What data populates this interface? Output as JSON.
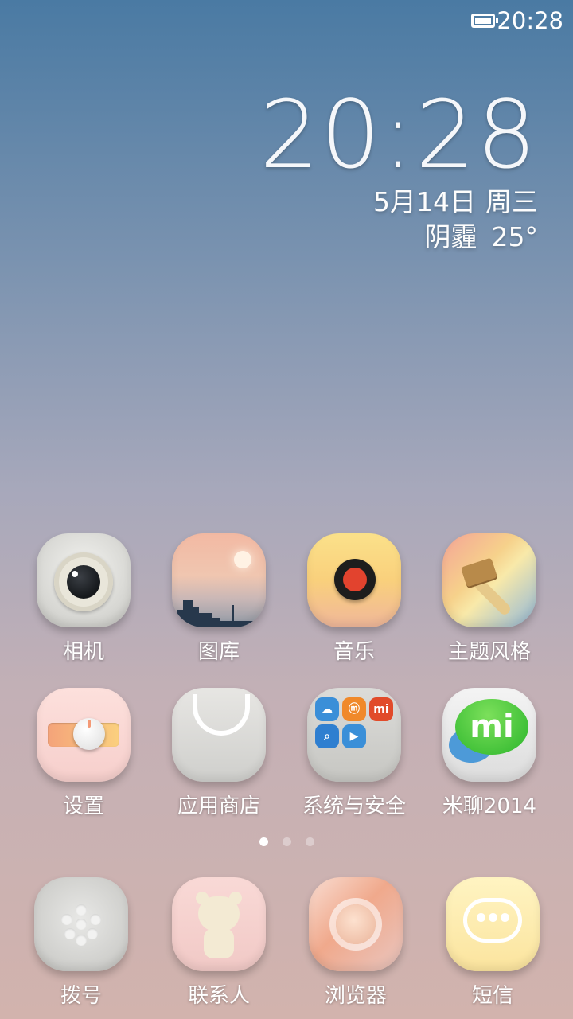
{
  "status_bar": {
    "time": "20:28",
    "battery_icon": "battery-full-icon"
  },
  "clock_widget": {
    "time": "20:28",
    "date": "5月14日",
    "weekday": "周三",
    "weather": "阴霾",
    "temperature": "25°"
  },
  "apps": [
    {
      "label": "相机",
      "icon": "camera-icon"
    },
    {
      "label": "图库",
      "icon": "gallery-icon"
    },
    {
      "label": "音乐",
      "icon": "music-icon"
    },
    {
      "label": "主题风格",
      "icon": "theme-brush-icon"
    },
    {
      "label": "设置",
      "icon": "settings-toggle-icon"
    },
    {
      "label": "应用商店",
      "icon": "app-store-bag-icon"
    },
    {
      "label": "系统与安全",
      "icon": "folder-icon"
    },
    {
      "label": "米聊2014",
      "icon": "mitalk-icon"
    }
  ],
  "folder_minis": [
    "cloud",
    "mi",
    "mi",
    "search",
    "play"
  ],
  "mitalk_text": "mi",
  "page_indicator": {
    "pages": 3,
    "active": 0
  },
  "dock": [
    {
      "label": "拨号",
      "icon": "dialer-icon"
    },
    {
      "label": "联系人",
      "icon": "contacts-icon"
    },
    {
      "label": "浏览器",
      "icon": "browser-icon"
    },
    {
      "label": "短信",
      "icon": "sms-icon"
    }
  ]
}
